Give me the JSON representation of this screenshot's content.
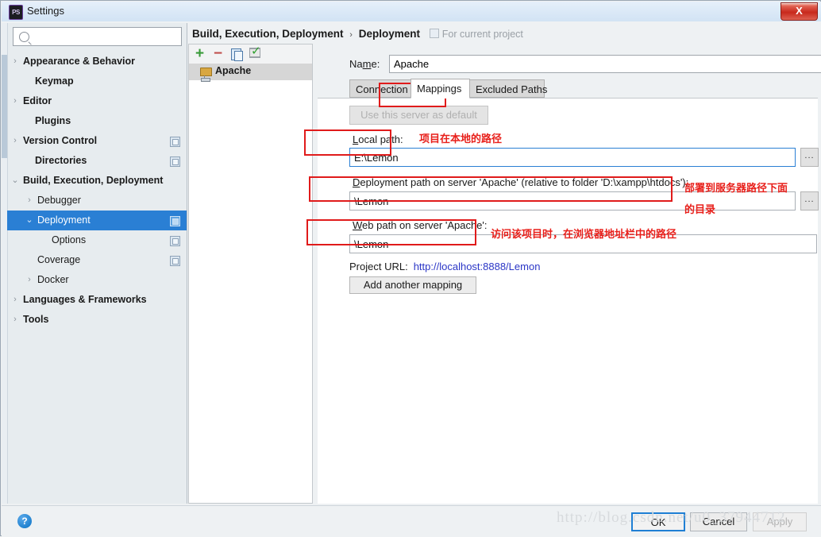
{
  "window": {
    "title": "Settings",
    "app_icon": "photoshop-ps-icon",
    "close_label": "X"
  },
  "search": {
    "value": "",
    "placeholder": ""
  },
  "sidebar": {
    "items": [
      {
        "label": "Appearance & Behavior",
        "arrow": "›",
        "bold": true,
        "indent": 20,
        "copy": false,
        "selected": false
      },
      {
        "label": "Keymap",
        "arrow": "",
        "bold": true,
        "indent": 35,
        "copy": false,
        "selected": false
      },
      {
        "label": "Editor",
        "arrow": "›",
        "bold": true,
        "indent": 20,
        "copy": false,
        "selected": false
      },
      {
        "label": "Plugins",
        "arrow": "",
        "bold": true,
        "indent": 35,
        "copy": false,
        "selected": false
      },
      {
        "label": "Version Control",
        "arrow": "›",
        "bold": true,
        "indent": 20,
        "copy": true,
        "selected": false
      },
      {
        "label": "Directories",
        "arrow": "",
        "bold": true,
        "indent": 35,
        "copy": true,
        "selected": false
      },
      {
        "label": "Build, Execution, Deployment",
        "arrow": "⌄",
        "bold": true,
        "indent": 20,
        "copy": false,
        "selected": false
      },
      {
        "label": "Debugger",
        "arrow": "›",
        "bold": false,
        "indent": 38,
        "copy": false,
        "selected": false
      },
      {
        "label": "Deployment",
        "arrow": "⌄",
        "bold": false,
        "indent": 38,
        "copy": true,
        "selected": true
      },
      {
        "label": "Options",
        "arrow": "",
        "bold": false,
        "indent": 56,
        "copy": true,
        "selected": false
      },
      {
        "label": "Coverage",
        "arrow": "",
        "bold": false,
        "indent": 38,
        "copy": true,
        "selected": false
      },
      {
        "label": "Docker",
        "arrow": "›",
        "bold": false,
        "indent": 38,
        "copy": false,
        "selected": false
      },
      {
        "label": "Languages & Frameworks",
        "arrow": "›",
        "bold": true,
        "indent": 20,
        "copy": false,
        "selected": false
      },
      {
        "label": "Tools",
        "arrow": "›",
        "bold": true,
        "indent": 20,
        "copy": false,
        "selected": false
      }
    ]
  },
  "header": {
    "crumb1": "Build, Execution, Deployment",
    "separator": "›",
    "crumb2": "Deployment",
    "scope_note": "For current project"
  },
  "server_toolbar": {
    "add": "+",
    "remove": "−",
    "copy": "copy-icon",
    "validate": "validate-icon"
  },
  "server_list": {
    "items": [
      {
        "name": "Apache",
        "selected": true
      }
    ]
  },
  "form": {
    "name_label": "Na",
    "name_label_mnemonic": "m",
    "name_label_rest": "e:",
    "name_value": "Apache",
    "tabs": [
      {
        "label": "Connection",
        "active": false
      },
      {
        "label": "Mappings",
        "active": true
      },
      {
        "label": "Excluded Paths",
        "active": false
      }
    ],
    "use_default_button": "Use this server as default",
    "local_path": {
      "label_mnemonic": "L",
      "label_rest": "ocal path:",
      "value": "E:\\Lemon",
      "browse": "..."
    },
    "deployment_path": {
      "label_mnemonic": "D",
      "label_rest": "eployment path on server 'Apache' (relative to folder 'D:\\xampp\\htdocs'):",
      "value": "\\Lemon",
      "browse": "..."
    },
    "web_path": {
      "label_mnemonic": "W",
      "label_rest": "eb path on server 'Apache':",
      "value": "\\Lemon"
    },
    "project_url_label": "Project URL:",
    "project_url_value": "http://localhost:8888/Lemon",
    "add_mapping_button": "Add another mapping"
  },
  "annotations": {
    "local_path_note": "项目在本地的路径",
    "deployment_note_line1": "部署到服务器路径下面",
    "deployment_note_line2": "的目录",
    "web_path_note": "访问该项目时，在浏览器地址栏中的路径",
    "highlight_color": "#e01b1b"
  },
  "footer": {
    "help": "?",
    "ok": "OK",
    "cancel": "Cancel",
    "apply": "Apply",
    "watermark": "http://blog.csdn.net/u0_37944712"
  }
}
